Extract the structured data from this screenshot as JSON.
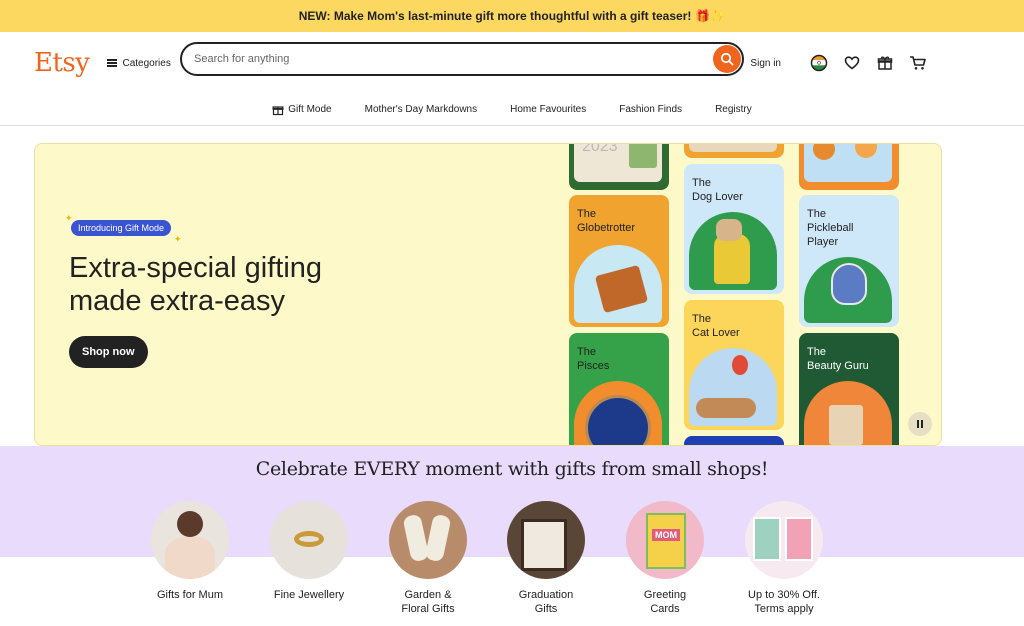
{
  "promo": {
    "text": "NEW: Make Mom's last-minute gift more thoughtful with a gift teaser!",
    "emoji": "🎁✨"
  },
  "header": {
    "logo": "Etsy",
    "categories_label": "Categories",
    "search_placeholder": "Search for anything",
    "signin_label": "Sign in"
  },
  "subnav": {
    "items": [
      "Gift Mode",
      "Mother's Day Markdowns",
      "Home Favourites",
      "Fashion Finds",
      "Registry"
    ]
  },
  "hero": {
    "badge": "Introducing Gift Mode",
    "headline_line1": "Extra-special gifting",
    "headline_line2": "made extra-easy",
    "cta": "Shop now",
    "tiles": {
      "globetrotter": [
        "The",
        "Globetrotter"
      ],
      "dog_lover": [
        "The",
        "Dog Lover"
      ],
      "pickleball": [
        "The",
        "Pickleball",
        "Player"
      ],
      "pisces": [
        "The",
        "Pisces"
      ],
      "cat_lover": [
        "The",
        "Cat Lover"
      ],
      "beauty_guru": [
        "The",
        "Beauty Guru"
      ],
      "calendar_text": "2023"
    }
  },
  "celebrate": {
    "title": "Celebrate EVERY moment with gifts from small shops!",
    "items": [
      {
        "line1": "Gifts for Mum",
        "line2": ""
      },
      {
        "line1": "Fine Jewellery",
        "line2": ""
      },
      {
        "line1": "Garden &",
        "line2": "Floral Gifts"
      },
      {
        "line1": "Graduation",
        "line2": "Gifts"
      },
      {
        "line1": "Greeting",
        "line2": "Cards"
      },
      {
        "line1": "Up to 30% Off.",
        "line2": "Terms apply"
      }
    ],
    "card_text": "MOM"
  },
  "colors": {
    "brand": "#f1641e",
    "promo_bg": "#fdd860",
    "hero_bg": "#fdf9c9",
    "celebrate_bg": "#e8dbfb",
    "badge": "#3a54d1"
  }
}
